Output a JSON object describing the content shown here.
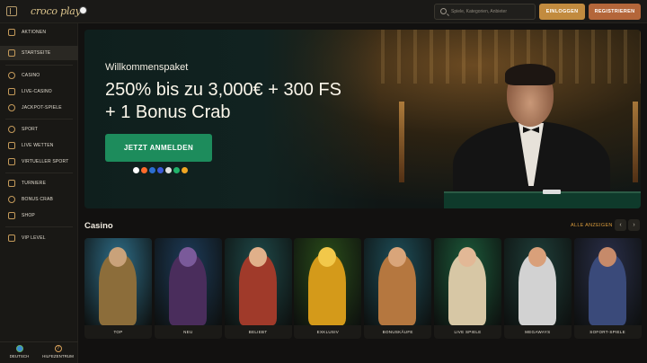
{
  "header": {
    "logo_text": "croco play",
    "search_placeholder": "Spiele, Kategorien, Anbieter",
    "login_label": "EINLOGGEN",
    "register_label": "REGISTRIEREN"
  },
  "sidebar": {
    "items": [
      {
        "label": "AKTIONEN",
        "icon": "gift-icon"
      },
      {
        "label": "STARTSEITE",
        "icon": "home-icon",
        "active": true
      },
      {
        "label": "CASINO",
        "icon": "casino-icon"
      },
      {
        "label": "LIVE-CASINO",
        "icon": "live-casino-icon"
      },
      {
        "label": "JACKPOT-SPIELE",
        "icon": "jackpot-icon"
      },
      {
        "label": "SPORT",
        "icon": "sport-icon"
      },
      {
        "label": "LIVE WETTEN",
        "icon": "live-bet-icon"
      },
      {
        "label": "VIRTUELLER SPORT",
        "icon": "virtual-sport-icon"
      },
      {
        "label": "TURNIERE",
        "icon": "tournament-icon"
      },
      {
        "label": "BONUS CRAB",
        "icon": "crab-icon"
      },
      {
        "label": "SHOP",
        "icon": "shop-icon"
      },
      {
        "label": "VIP LEVEL",
        "icon": "crown-icon"
      }
    ],
    "footer": {
      "language_label": "DEUTSCH",
      "help_label": "HILFEZENTRUM"
    }
  },
  "hero": {
    "subtitle": "Willkommenspaket",
    "title": "250% bis zu 3,000€ + 300 FS + 1 Bonus Crab",
    "cta_label": "JETZT ANMELDEN",
    "payment_colors": [
      "#ffffff",
      "#ff6b2b",
      "#2c6fd1",
      "#3b5bd9",
      "#e1e1e1",
      "#21b36a",
      "#f0a623"
    ]
  },
  "casino": {
    "title": "Casino",
    "see_all_label": "ALLE ANZEIGEN",
    "prev_label": "‹",
    "next_label": "›",
    "categories": [
      {
        "label": "TOP",
        "bg": "#2f6f8a",
        "fig": "#8c6d3a",
        "head": "#c9a27a"
      },
      {
        "label": "NEU",
        "bg": "#1d3c5a",
        "fig": "#4a2d5c",
        "head": "#7a5a9a"
      },
      {
        "label": "BELIEBT",
        "bg": "#1f4a4a",
        "fig": "#a03a2a",
        "head": "#e0b08a"
      },
      {
        "label": "EXKLUSIV",
        "bg": "#2a4d1a",
        "fig": "#d49a1a",
        "head": "#f2c84a"
      },
      {
        "label": "BONUSKÄUFE",
        "bg": "#1e4f5a",
        "fig": "#b5773f",
        "head": "#d9a57a"
      },
      {
        "label": "LIVE SPIELE",
        "bg": "#1c5a3a",
        "fig": "#d7c7a5",
        "head": "#e2b896"
      },
      {
        "label": "MEGAWAYS",
        "bg": "#1f3f3a",
        "fig": "#d2d2d2",
        "head": "#d9a07a"
      },
      {
        "label": "SOFORT-SPIELE",
        "bg": "#2a2f4a",
        "fig": "#3a4a7a",
        "head": "#c68a6a"
      }
    ]
  }
}
